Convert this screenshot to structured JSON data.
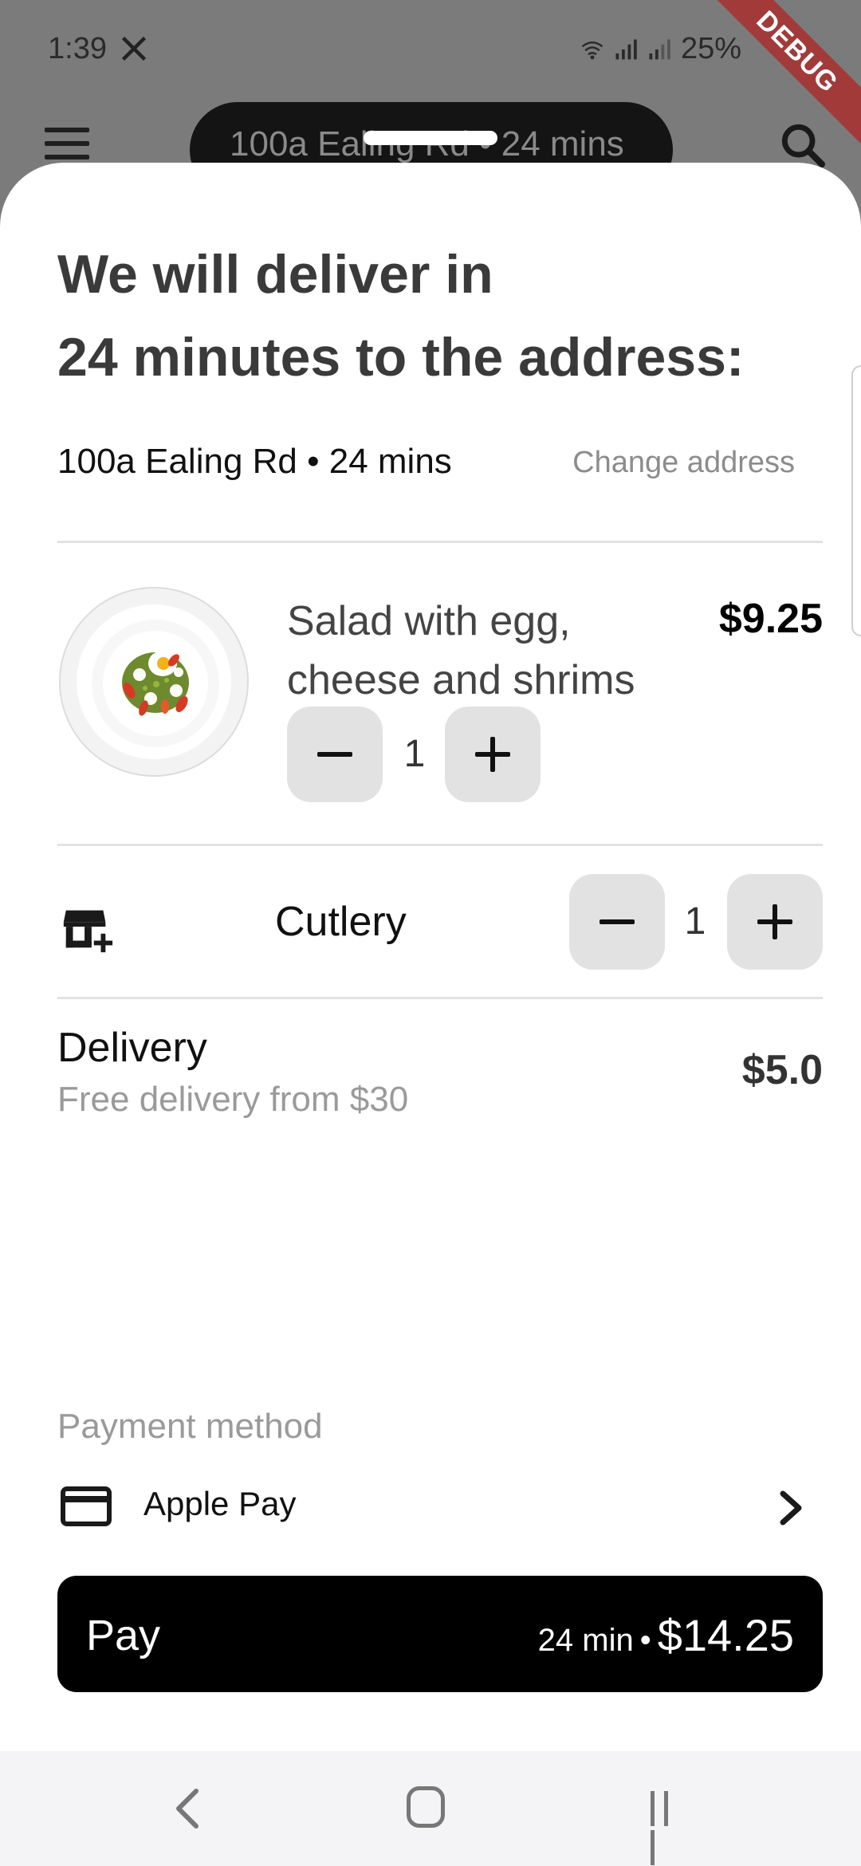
{
  "status_bar": {
    "time": "1:39",
    "battery": "25%",
    "debug_label": "DEBUG"
  },
  "top_bar": {
    "pill_text": "100a Ealing Rd • 24 mins"
  },
  "sheet": {
    "headline_line1": "We will deliver in",
    "headline_line2": "24 minutes to the address:",
    "address": "100a Ealing Rd • 24 mins",
    "change_address": "Change address"
  },
  "item": {
    "name_line1": "Salad with egg,",
    "name_line2": "cheese and shrims",
    "price": "$9.25",
    "quantity": "1"
  },
  "cutlery": {
    "label": "Cutlery",
    "quantity": "1"
  },
  "delivery": {
    "title": "Delivery",
    "subtitle": "Free delivery from $30",
    "price": "$5.0"
  },
  "payment": {
    "label": "Payment method",
    "method": "Apple Pay"
  },
  "pay_button": {
    "label": "Pay",
    "time": "24 min",
    "separator": "•",
    "total": "$14.25"
  },
  "icons": {
    "menu": "menu-icon",
    "search": "search-icon",
    "cutlery": "store-add-icon",
    "card": "credit-card-icon",
    "chevron": "chevron-right-icon"
  }
}
